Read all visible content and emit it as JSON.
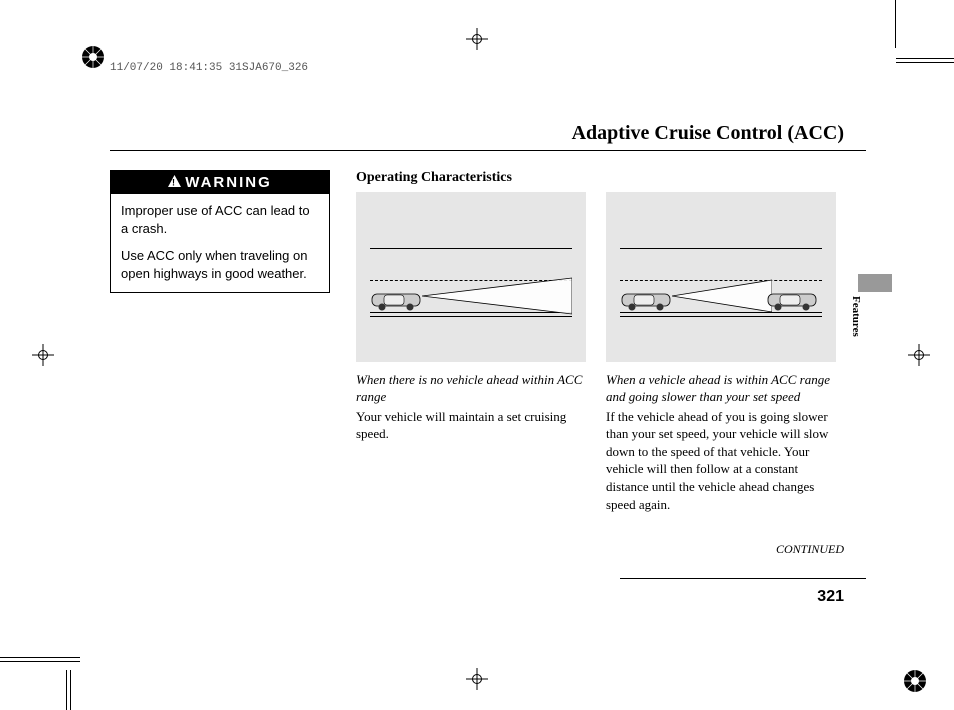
{
  "header_stamp": "11/07/20 18:41:35 31SJA670_326",
  "page_title": "Adaptive Cruise Control (ACC)",
  "warning": {
    "label": "WARNING",
    "line1": "Improper use of ACC can lead to a crash.",
    "line2": "Use ACC only when traveling on open highways in good weather."
  },
  "section_heading": "Operating Characteristics",
  "scenario1": {
    "caption_italic": "When there is no vehicle ahead within ACC range",
    "caption_body": "Your vehicle will maintain a set cruising speed."
  },
  "scenario2": {
    "caption_italic": "When a vehicle ahead is within ACC range and going slower than your set speed",
    "caption_body": "If the vehicle ahead of you is going slower than your set speed, your vehicle will slow down to the speed of that vehicle. Your vehicle will then follow at a constant distance until the vehicle ahead changes speed again."
  },
  "side_label": "Features",
  "continued": "CONTINUED",
  "page_number": "321"
}
